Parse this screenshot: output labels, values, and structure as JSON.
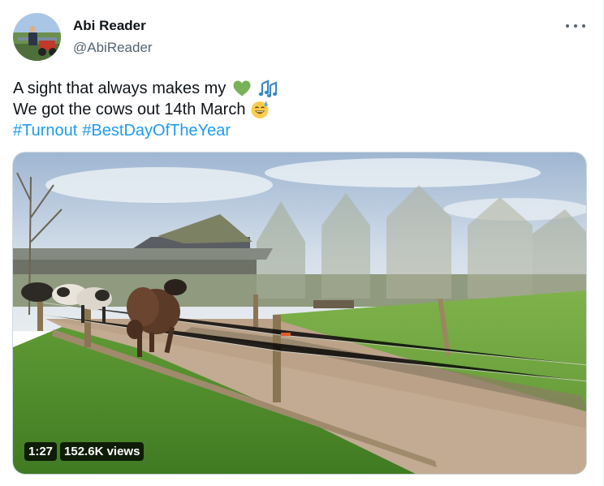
{
  "author": {
    "display_name": "Abi Reader",
    "handle": "@AbiReader"
  },
  "tweet": {
    "line1": "A sight that always makes my",
    "line1_emojis": [
      "green-heart-emoji",
      "musical-notes-emoji"
    ],
    "line2": "We got the cows out 14th March",
    "line2_emoji": "sweat-smile-emoji",
    "hashtags": [
      "#Turnout",
      "#BestDayOfTheYear"
    ]
  },
  "video": {
    "duration": "1:27",
    "views": "152.6K views"
  },
  "colors": {
    "link": "#1d9bf0",
    "text": "#0f1419",
    "secondary": "#536471"
  }
}
